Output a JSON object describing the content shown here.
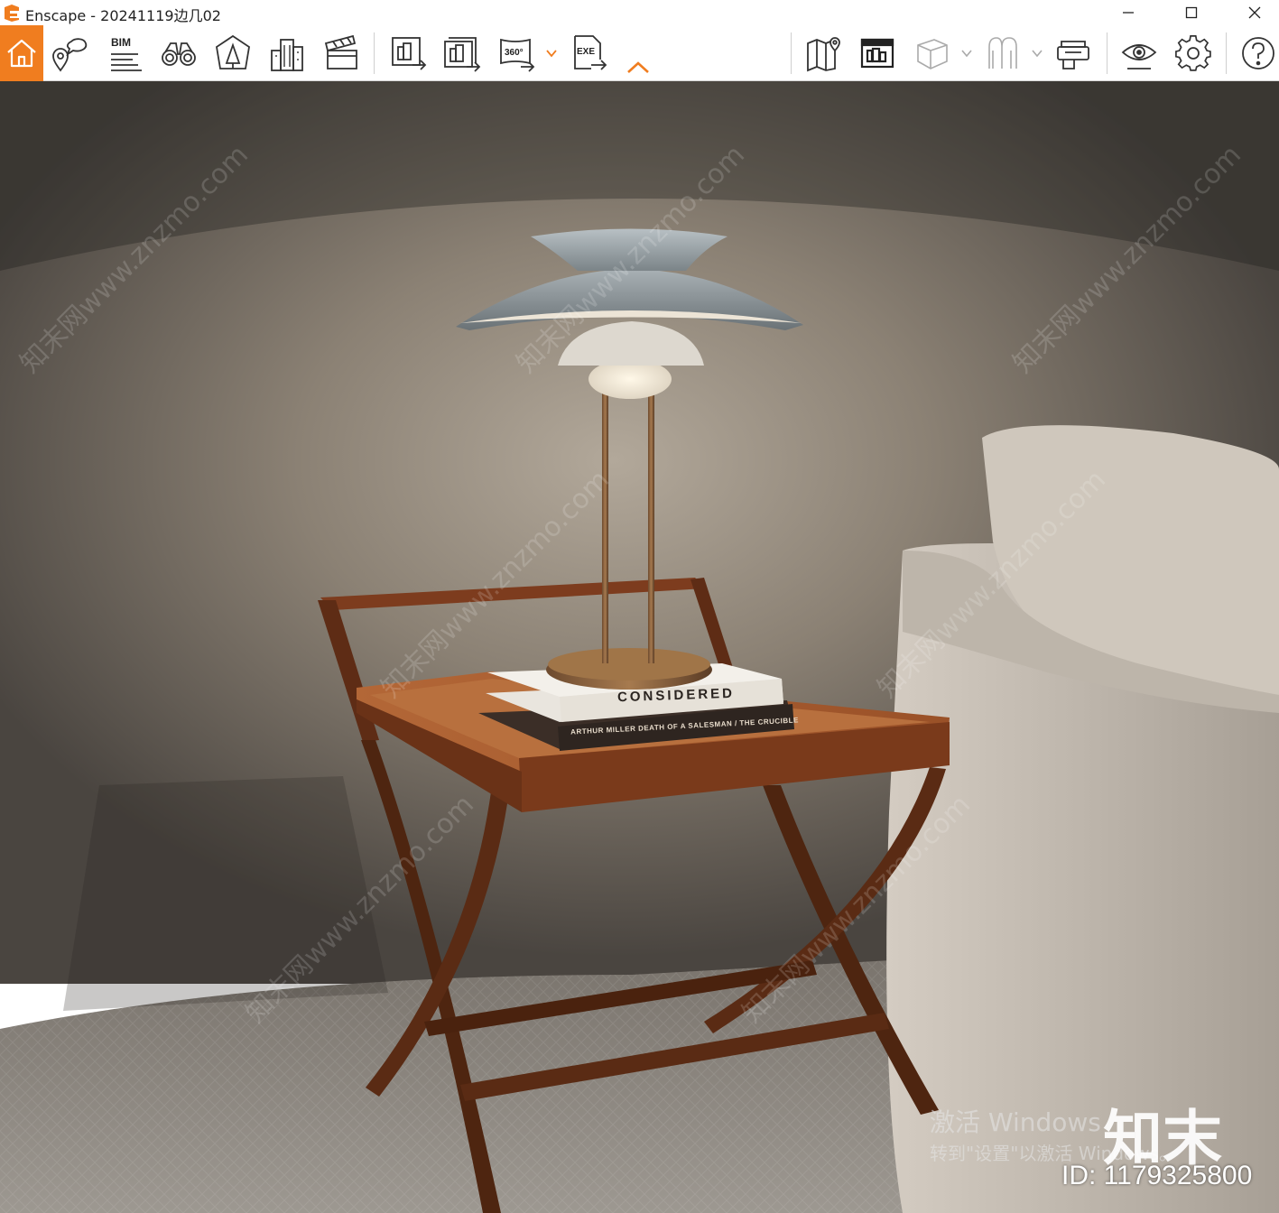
{
  "window": {
    "title": "Enscape - 20241119边几02",
    "controls": {
      "minimize": "minimize-icon",
      "maximize": "maximize-icon",
      "close": "close-icon"
    }
  },
  "toolbar": {
    "accent_color": "#f07d1f",
    "buttons": [
      {
        "id": "home",
        "icon": "home-icon",
        "active": true
      },
      {
        "id": "views",
        "icon": "location-pin-icon"
      },
      {
        "id": "bim",
        "icon": "bim-icon",
        "label": "BIM"
      },
      {
        "id": "binoculars",
        "icon": "binoculars-icon"
      },
      {
        "id": "assets",
        "icon": "asset-library-icon"
      },
      {
        "id": "buildings",
        "icon": "buildings-icon"
      },
      {
        "id": "video",
        "icon": "clapperboard-icon"
      },
      {
        "id": "render-image",
        "icon": "render-image-icon"
      },
      {
        "id": "batch-render",
        "icon": "batch-render-icon"
      },
      {
        "id": "panorama",
        "icon": "panorama-icon",
        "label": "360°"
      },
      {
        "id": "export-exe",
        "icon": "export-exe-icon",
        "label": "EXE"
      },
      {
        "id": "map",
        "icon": "map-icon"
      },
      {
        "id": "view-mgmt",
        "icon": "view-management-icon"
      },
      {
        "id": "cube",
        "icon": "cube-icon"
      },
      {
        "id": "atmosphere",
        "icon": "atmosphere-icon"
      },
      {
        "id": "vr",
        "icon": "vr-headset-icon"
      },
      {
        "id": "visual-settings",
        "icon": "eye-icon"
      },
      {
        "id": "settings",
        "icon": "gear-icon"
      },
      {
        "id": "help",
        "icon": "help-icon"
      }
    ]
  },
  "viewport": {
    "book_title": "CONSIDERED",
    "book_spine": "ARTHUR MILLER  DEATH OF A SALESMAN / THE CRUCIBLE"
  },
  "overlay": {
    "activate_line1": "激活 Windows",
    "activate_line2": "转到\"设置\"以激活 Windows。",
    "brand": "知末",
    "id_label": "ID: 1179325800",
    "watermark": "知末网www.znzmo.com"
  }
}
